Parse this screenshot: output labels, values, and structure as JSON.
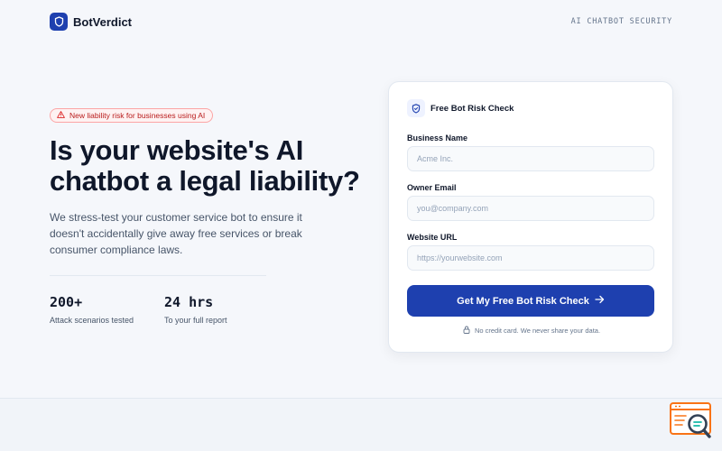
{
  "brand": {
    "name": "BotVerdict",
    "tagline": "AI CHATBOT SECURITY"
  },
  "hero": {
    "badge": "New liability risk for businesses using AI",
    "headline": "Is your website's AI chatbot a legal liability?",
    "lede": "We stress-test your customer service bot to ensure it doesn't accidentally give away free services or break consumer compliance laws.",
    "stats": [
      {
        "value": "200+",
        "label": "Attack scenarios tested"
      },
      {
        "value": "24 hrs",
        "label": "To your full report"
      }
    ]
  },
  "form": {
    "title": "Free Bot Risk Check",
    "fields": [
      {
        "label": "Business Name",
        "placeholder": "Acme Inc."
      },
      {
        "label": "Owner Email",
        "placeholder": "you@company.com"
      },
      {
        "label": "Website URL",
        "placeholder": "https://yourwebsite.com"
      }
    ],
    "submit_label": "Get My Free Bot Risk Check",
    "note": "No credit card. We never share your data."
  },
  "colors": {
    "accent": "#1e40af",
    "warning": "#b91c1c",
    "widget": "#f97316"
  },
  "icons": {
    "logo": "shield-icon",
    "badge": "warning-triangle-icon",
    "card": "shield-icon",
    "submit": "arrow-right-icon",
    "note": "lock-icon",
    "widget": "search-chat-icon"
  }
}
